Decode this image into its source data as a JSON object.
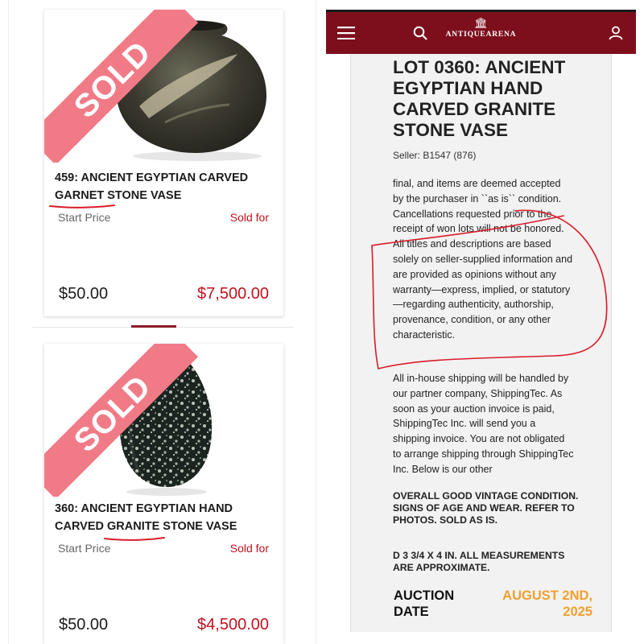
{
  "colors": {
    "brand": "#7d0f1c",
    "sold_price": "#c2111e",
    "ribbon": "#f07b87",
    "auction_date": "#f0a030",
    "annotation": "#d81c2a"
  },
  "listings": [
    {
      "ribbon": "SOLD",
      "title": "459: ANCIENT EGYPTIAN CARVED GARNET STONE VASE",
      "start_label": "Start Price",
      "sold_label": "Sold for",
      "start_price": "$50.00",
      "sold_price": "$7,500.00",
      "image": "garnet-stone-vase-photo"
    },
    {
      "ribbon": "SOLD",
      "title": "360: ANCIENT EGYPTIAN HAND CARVED GRANITE STONE VASE",
      "start_label": "Start Price",
      "sold_label": "Sold for",
      "start_price": "$50.00",
      "sold_price": "$4,500.00",
      "image": "granite-stone-vase-photo"
    }
  ],
  "lot_page": {
    "header": {
      "menu_icon": "hamburger-menu-icon",
      "search_icon": "search-icon",
      "logo_mark": "🏛",
      "logo_text": "ANTIQUEARENA",
      "account_icon": "user-icon"
    },
    "title": "LOT 0360: ANCIENT EGYPTIAN HAND CARVED GRANITE STONE VASE",
    "seller": "Seller: B1547 (876)",
    "terms_paragraph": "final, and items are deemed accepted by the purchaser in ``as is`` condition. Cancellations requested prior to the receipt of won lots will not be honored. All titles and descriptions are based solely on seller-supplied information and are provided as opinions without any warranty—express, implied, or statutory—regarding authenticity, authorship, provenance, condition, or any other characteristic.",
    "shipping_paragraph": "All in-house shipping will be handled by our partner company, ShippingTec. As soon as your auction invoice is paid, ShippingTec Inc. will send you a shipping invoice. You are not obligated to arrange shipping through ShippingTec Inc. Below is our other",
    "condition": "OVERALL GOOD VINTAGE CONDITION. SIGNS OF AGE AND WEAR. REFER TO PHOTOS. SOLD AS IS.",
    "dimensions": "D 3 3/4 X 4 IN. ALL MEASUREMENTS ARE APPROXIMATE.",
    "auction_date_label": "AUCTION DATE",
    "auction_date_value": "AUGUST 2ND, 2025"
  }
}
